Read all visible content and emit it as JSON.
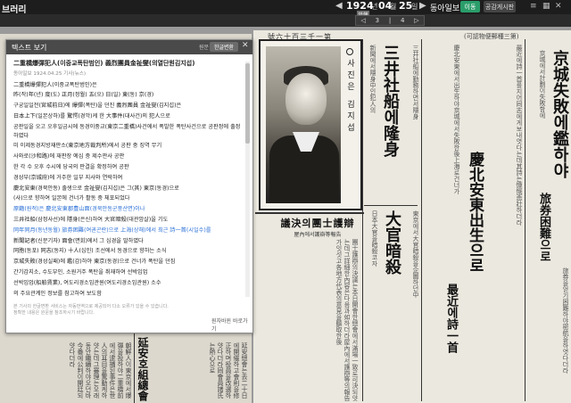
{
  "topbar": {
    "brand": "브러리",
    "year": "1924",
    "year_unit": "년",
    "month": "04",
    "month_unit": "월",
    "day": "25",
    "day_unit": "일",
    "paper_name": "동아일보",
    "primary_button": "이동",
    "secondary_button": "공감게시판"
  },
  "pager": {
    "tooltip": "발행",
    "current": "3",
    "total": "4"
  },
  "newspaper": {
    "masthead": "號六十百三千一第",
    "masthead_right": "(可認物便郵種三第)",
    "portrait_caption": "사진은 김지섭",
    "headlines": {
      "h1": "三井社船에隆身",
      "h2": "大官暗殺",
      "h3": "慶北安東出生으로",
      "h4": "京城失敗에鑑하야",
      "h5": "旅券困難으로",
      "h6": "最近에詩一首",
      "box_title": "議決의團士護辯",
      "box_sub": "屋內에서護辯等報告",
      "bottom": "延安호組總會"
    }
  },
  "text_panel": {
    "title": "텍스트 보기",
    "zoom_label": "원문",
    "convert_button": "한글변환",
    "heading": "二重橋爆彈犯人(이중교폭탄범인) 義烈團員金祉燮(의열단원김지섭)",
    "meta": "동아일보 1924.04.25 기사(뉴스)",
    "paragraphs": [
      "二重橋爆彈犯人(이중교폭탄범인)은",
      "昨(작)年(년) 度(도) 正月(정월) 五(오) 日(일) 東(동) 京(경)",
      "구궁일일전(宮城前日)에 爆彈(폭탄)을 던진 義烈團員 金祉燮(김지섭)은",
      "日本上下(일본상하)를 驚愕(경악)케 한 大事件(대사건)의 犯人으로",
      "공판일을 오고 오후일금시에 동경이중교(東京二重橋)사건에서 폭발한 폭탄사건으로 공판정에 출정하였다",
      "미 이제동경지방재판소(東京地方裁判所)에서 공판 중 징역 무기",
      "사와로(沙和路)에 재판장 예심 중 제수판사 공판",
      "한 각 수 오후 수시에 당국의 판결을 확정하여 공판",
      "경성부(京城府)에 거주한 일부 지사와 연락하여",
      "慶北安東(경북안동) 출생으로 金祉燮(김지섭)은 그(其) 東京(동경)으로",
      "(사)으로 향하여 일본에 건너가 활동 중 체포되었다",
      "原籍(원적)은 慶北安東郡豊山面(경북안동군풍산면)이나",
      "三井社船(삼정사선)에 隱身(은신)하여 大官暗殺(대관암살)을 기도",
      "同年同月(동년동월) 旅券困難(여권곤란)으로 上海(상해)에서 최근 詩一首(시일수)를",
      "新聞記者(신문기자) 面會(면회)에서 그 심경을 말하였다",
      "同胞(동포) 同志(동지) 十人(십인) 조선에서 동경으로 향하는 소식",
      "京城失敗(경성실패)에 鑑(감)하야 東京(동경)으로 건너가 폭탄을 던짐",
      "간기감지소, 수도부인, 소원거주 폭탄을 취재하여 선박임업",
      "선박임업(船舶賃業), 여도리경소임관원(여도리경소임관원) 소수",
      "의 주요관계인 정보를 참고하여 보도함"
    ],
    "footer_line1": "본 기사의 한글변환 서비스는 자동번역으로 제공되어 다소 오류가 있을 수 있습니다.",
    "footer_line2": "정확한 내용은 원문을 참조하시기 바랍니다.",
    "more_link": "원자바윈 바로가기"
  }
}
